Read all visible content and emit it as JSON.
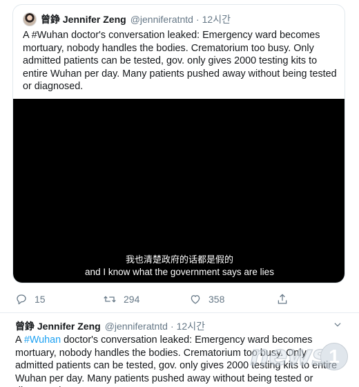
{
  "quoted_tweet": {
    "author_name": "曾錚 Jennifer Zeng",
    "author_handle": "@jenniferatntd",
    "time": "12시간",
    "text": "A #Wuhan doctor's conversation leaked: Emergency ward becomes mortuary, nobody handles the bodies. Crematorium too busy. Only admitted patients can be tested, gov. only gives 2000 testing kits to entire Wuhan per day. Many patients pushed away without being tested or diagnosed.",
    "video": {
      "subtitle_zh": "我也清楚政府的话都是假的",
      "subtitle_en": "and I know what the government says are lies"
    }
  },
  "actions": {
    "reply_count": "15",
    "retweet_count": "294",
    "like_count": "358"
  },
  "tweet2": {
    "author_name": "曾錚 Jennifer Zeng",
    "author_handle": "@jenniferatntd",
    "time": "12시간",
    "text_prefix": "A ",
    "hashtag": "#Wuhan",
    "text_rest": " doctor's conversation leaked: Emergency ward becomes mortuary, nobody handles the bodies. Crematorium too busy. Only admitted patients can be tested, gov. only gives 2000 testing kits to entire Wuhan per day. Many patients pushed away without being tested or diagnosed."
  },
  "watermark": {
    "text": "news",
    "badge": "1"
  },
  "colors": {
    "link": "#1da1f2",
    "muted": "#657786",
    "border": "#e1e8ed"
  },
  "icons": [
    "reply-icon",
    "retweet-icon",
    "like-icon",
    "share-icon",
    "chevron-down-icon"
  ]
}
